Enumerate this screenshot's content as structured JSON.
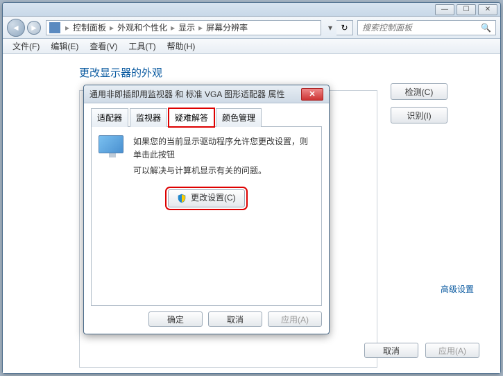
{
  "window": {
    "min_glyph": "—",
    "max_glyph": "☐",
    "close_glyph": "✕"
  },
  "nav": {
    "back_glyph": "◄",
    "fwd_glyph": "►",
    "drop_glyph": "▾",
    "refresh_glyph": "↻"
  },
  "breadcrumb": {
    "sep": "▸",
    "items": [
      "控制面板",
      "外观和个性化",
      "显示",
      "屏幕分辨率"
    ]
  },
  "search": {
    "placeholder": "搜索控制面板",
    "icon": "🔍"
  },
  "menus": {
    "file": "文件(F)",
    "edit": "编辑(E)",
    "view": "查看(V)",
    "tools": "工具(T)",
    "help": "帮助(H)"
  },
  "page": {
    "title": "更改显示器的外观",
    "detect": "检测(C)",
    "identify": "识别(I)",
    "advanced": "高级设置",
    "cancel": "取消",
    "apply": "应用(A)"
  },
  "dialog": {
    "title": "通用非即插即用监视器 和 标准 VGA 图形适配器 属性",
    "close_glyph": "✕",
    "tabs": {
      "adapter": "适配器",
      "monitor": "监视器",
      "troubleshoot": "疑难解答",
      "color": "颜色管理"
    },
    "help_line1": "如果您的当前显示驱动程序允许您更改设置，则单击此按钮",
    "help_line2": "可以解决与计算机显示有关的问题。",
    "change_settings": "更改设置(C)",
    "ok": "确定",
    "cancel": "取消",
    "apply": "应用(A)"
  }
}
